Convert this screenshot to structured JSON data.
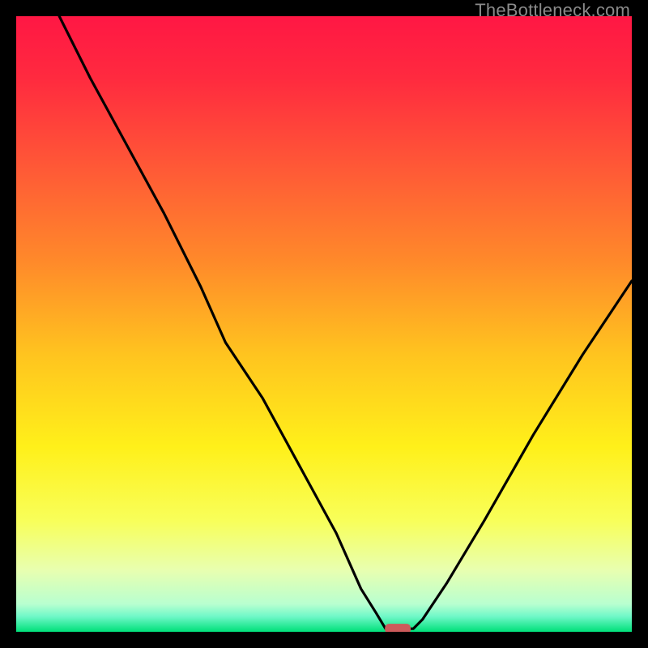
{
  "watermark": "TheBottleneck.com",
  "chart_data": {
    "type": "line",
    "title": "",
    "xlabel": "",
    "ylabel": "",
    "xlim": [
      0,
      100
    ],
    "ylim": [
      0,
      100
    ],
    "grid": false,
    "legend": false,
    "gradient_stops": [
      {
        "offset": 0.0,
        "color": "#ff1744"
      },
      {
        "offset": 0.1,
        "color": "#ff2a3f"
      },
      {
        "offset": 0.25,
        "color": "#ff5a36"
      },
      {
        "offset": 0.4,
        "color": "#ff8a2a"
      },
      {
        "offset": 0.55,
        "color": "#ffc41f"
      },
      {
        "offset": 0.7,
        "color": "#fff01a"
      },
      {
        "offset": 0.82,
        "color": "#f8ff5a"
      },
      {
        "offset": 0.9,
        "color": "#e8ffb0"
      },
      {
        "offset": 0.955,
        "color": "#b8ffd0"
      },
      {
        "offset": 0.975,
        "color": "#70f8c8"
      },
      {
        "offset": 1.0,
        "color": "#00e07a"
      }
    ],
    "series": [
      {
        "name": "bottleneck-curve",
        "color": "#000000",
        "x": [
          7,
          12,
          18,
          24,
          30,
          34,
          40,
          46,
          52,
          56,
          58.5,
          60,
          62,
          64.5,
          66,
          70,
          76,
          84,
          92,
          100
        ],
        "y": [
          100,
          90,
          79,
          68,
          56,
          47,
          38,
          27,
          16,
          7,
          3,
          0.5,
          0.5,
          0.5,
          2,
          8,
          18,
          32,
          45,
          57
        ]
      }
    ],
    "marker": {
      "name": "optimal-marker",
      "shape": "rounded-rect",
      "x": 62,
      "y": 0.5,
      "width_pct": 4.2,
      "height_pct": 1.6,
      "color": "#cc5a5a"
    }
  }
}
